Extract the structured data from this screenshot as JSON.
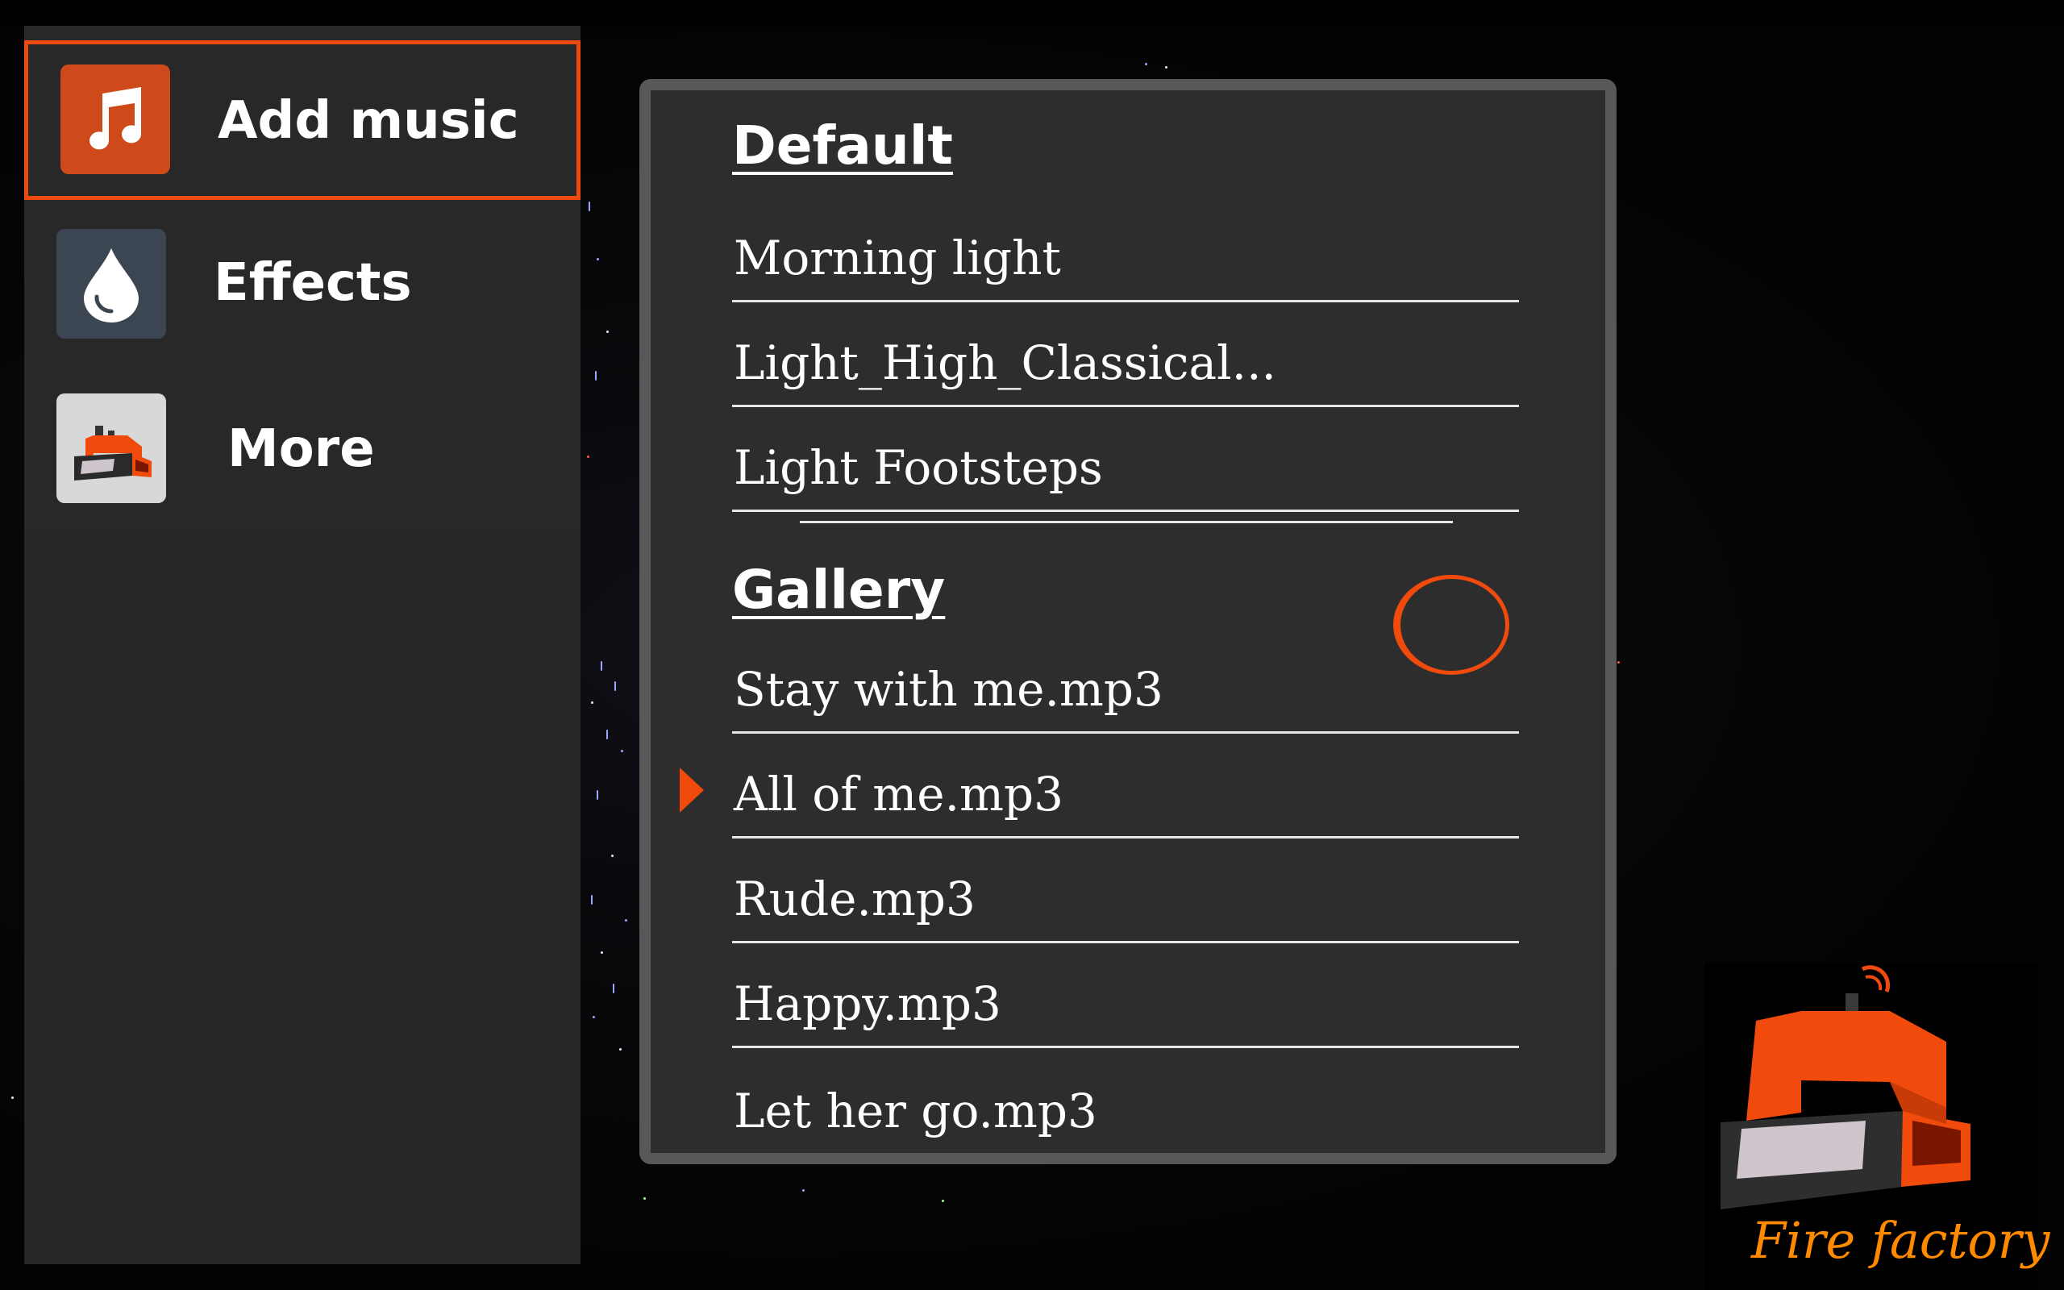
{
  "sidebar": {
    "items": [
      {
        "label": "Add music",
        "icon": "music-note-icon",
        "selected": true,
        "icon_bg": "#cf4a1a"
      },
      {
        "label": "Effects",
        "icon": "water-drop-icon",
        "selected": false,
        "icon_bg": "#3c4552"
      },
      {
        "label": "More",
        "icon": "factory-icon",
        "selected": false,
        "icon_bg": "#d8d8d8"
      }
    ]
  },
  "playlist": {
    "default_section": {
      "title": "Default",
      "tracks": [
        "Morning light",
        "Light_High_Classical...",
        "Light Footsteps"
      ]
    },
    "gallery_section": {
      "title": "Gallery",
      "tracks": [
        "Stay with me.mp3",
        "All of me.mp3",
        "Rude.mp3",
        "Happy.mp3",
        "Let her go.mp3"
      ],
      "playing_track": "All of me.mp3"
    }
  },
  "brand": {
    "name": "Fire factory",
    "icon": "fire-factory-logo-icon"
  },
  "colors": {
    "accent": "#f04a0c",
    "panel": "#282828",
    "dialog": "#2d2d2d",
    "dialog_border": "#585858",
    "brand_text": "#ff8a00"
  }
}
